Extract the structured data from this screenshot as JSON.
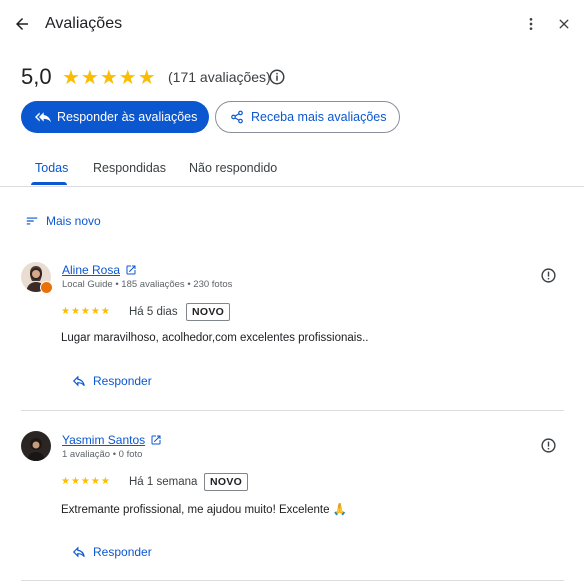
{
  "header": {
    "title": "Avaliações",
    "back_icon": "arrow-left-icon",
    "more_icon": "more-vert-icon",
    "close_icon": "close-icon"
  },
  "summary": {
    "rating": "5,0",
    "stars": "★★★★★",
    "count_text": "(171 avaliações)",
    "info_icon": "info-icon"
  },
  "actions": {
    "reply_label": "Responder às avaliações",
    "get_more_label": "Receba mais avaliações"
  },
  "tabs": [
    {
      "label": "Todas",
      "active": true
    },
    {
      "label": "Respondidas",
      "active": false
    },
    {
      "label": "Não respondido",
      "active": false
    }
  ],
  "sort": {
    "label": "Mais novo"
  },
  "reviews": [
    {
      "name": "Aline Rosa",
      "meta": "Local Guide • 185 avaliações • 230 fotos",
      "stars": "★★★★★",
      "date": "Há 5 dias",
      "badge": "NOVO",
      "text": "Lugar maravilhoso, acolhedor,com excelentes profissionais..",
      "reply_label": "Responder"
    },
    {
      "name": "Yasmim Santos",
      "meta": "1 avaliação • 0 foto",
      "stars": "★★★★★",
      "date": "Há 1 semana",
      "badge": "NOVO",
      "text": "Extremante profissional, me ajudou muito! Excelente 🙏",
      "reply_label": "Responder"
    }
  ],
  "colors": {
    "accent": "#0b57d0",
    "star": "#fbbc04",
    "divider": "#dadce0"
  }
}
